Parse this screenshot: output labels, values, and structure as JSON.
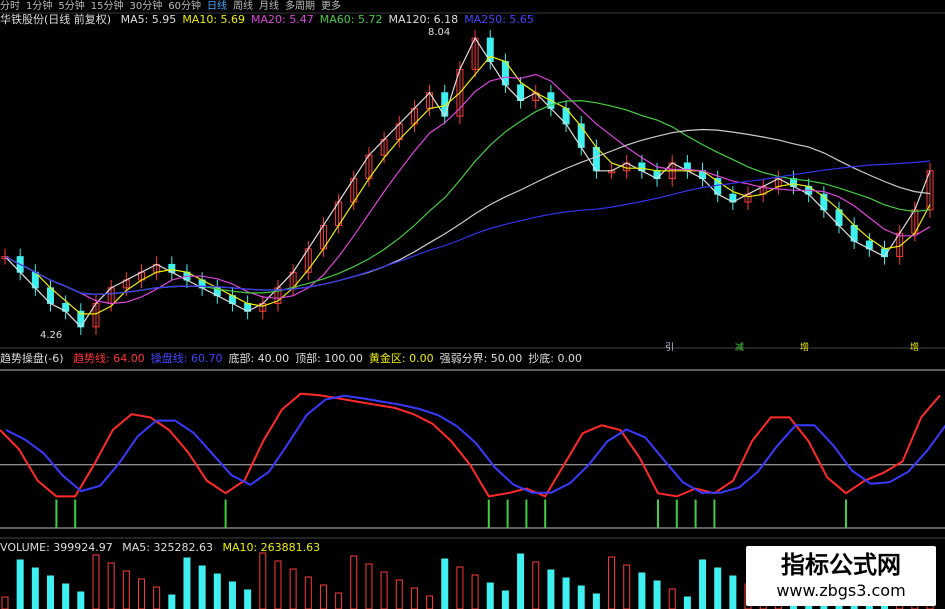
{
  "toolbar": {
    "items": [
      "分时",
      "1分钟",
      "5分钟",
      "15分钟",
      "30分钟",
      "60分钟",
      "日线",
      "周线",
      "月线",
      "多周期",
      "更多"
    ],
    "active": "日线"
  },
  "main": {
    "title": "华铁股份(日线 前复权)",
    "ma": [
      {
        "label": "MA5: 5.95",
        "color": "#dddddd"
      },
      {
        "label": "MA10: 5.69",
        "color": "#eeee00"
      },
      {
        "label": "MA20: 5.47",
        "color": "#dd44dd"
      },
      {
        "label": "MA60: 5.72",
        "color": "#44cc44"
      },
      {
        "label": "MA120: 6.18",
        "color": "#dddddd"
      },
      {
        "label": "MA250: 5.65",
        "color": "#4444ff"
      }
    ],
    "high_label": "8.04",
    "low_label": "4.26",
    "markers": [
      "引",
      "减",
      "增",
      "增"
    ]
  },
  "indicator": {
    "name": "趋势操盘(-6)",
    "items": [
      {
        "label": "趋势线: 64.00",
        "color": "#ff3333"
      },
      {
        "label": "操盘线: 60.70",
        "color": "#4444ff"
      },
      {
        "label": "底部: 40.00",
        "color": "#dddddd"
      },
      {
        "label": "顶部: 100.00",
        "color": "#dddddd"
      },
      {
        "label": "黄金区: 0.00",
        "color": "#eeee00"
      },
      {
        "label": "强弱分界: 50.00",
        "color": "#dddddd"
      },
      {
        "label": "抄底: 0.00",
        "color": "#dddddd"
      }
    ]
  },
  "volume": {
    "label": "VOLUME: 399924.97",
    "ma5": "MA5: 325282.63",
    "ma10": "MA10: 263881.63"
  },
  "watermark": {
    "title": "指标公式网",
    "url": "www.zbgs3.com"
  },
  "chart_data": {
    "type": "candlestick",
    "price_range": [
      4.26,
      8.04
    ],
    "closes": [
      5.2,
      5.0,
      4.8,
      4.6,
      4.5,
      4.3,
      4.6,
      4.8,
      4.9,
      5.0,
      5.1,
      5.0,
      4.9,
      4.8,
      4.7,
      4.6,
      4.5,
      4.6,
      4.8,
      5.0,
      5.3,
      5.6,
      5.9,
      6.2,
      6.5,
      6.7,
      6.9,
      7.1,
      7.3,
      7.0,
      7.6,
      8.0,
      7.7,
      7.4,
      7.2,
      7.3,
      7.1,
      6.9,
      6.6,
      6.3,
      6.3,
      6.4,
      6.3,
      6.2,
      6.4,
      6.3,
      6.2,
      6.0,
      5.9,
      6.0,
      6.1,
      6.2,
      6.1,
      6.0,
      5.8,
      5.6,
      5.4,
      5.3,
      5.2,
      5.5,
      5.8,
      6.3
    ],
    "ma_colors": [
      "#dddddd",
      "#eeee00",
      "#dd44dd",
      "#44cc44",
      "#cccccc",
      "#3333ee"
    ],
    "trend_line": [
      62,
      50,
      30,
      20,
      20,
      40,
      62,
      72,
      70,
      62,
      48,
      30,
      22,
      30,
      55,
      75,
      85,
      84,
      82,
      80,
      78,
      76,
      72,
      66,
      55,
      40,
      20,
      22,
      25,
      20,
      40,
      60,
      65,
      62,
      45,
      22,
      20,
      25,
      22,
      30,
      55,
      70,
      70,
      55,
      32,
      22,
      30,
      35,
      42,
      70,
      84
    ]
  }
}
